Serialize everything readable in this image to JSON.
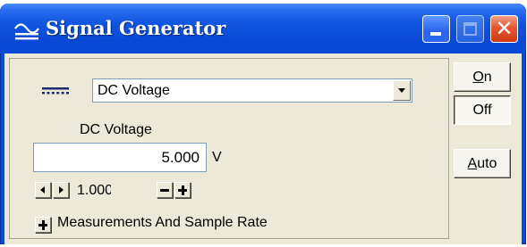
{
  "window": {
    "title": "Signal Generator",
    "icon": "signal-generator-icon",
    "controls": [
      "minimize-icon",
      "maximize-icon",
      "close-icon"
    ],
    "close_glyph": "✕"
  },
  "signal_type": {
    "icon": "dc-signal-icon",
    "selected": "DC Voltage"
  },
  "amplitude": {
    "label": "DC Voltage",
    "value": "5.000",
    "unit": "V",
    "step_value": "1.000"
  },
  "buttons": {
    "on_label": "On",
    "on_accel": "O",
    "on_rest": "n",
    "off_label": "Off",
    "auto_label": "Auto",
    "auto_accel": "A",
    "auto_rest": "uto"
  },
  "measurements": {
    "expand_glyph": "+",
    "label": "Measurements And Sample Rate"
  },
  "colors": {
    "titlebar": "#0b4ad1",
    "client_background": "#ece9d8",
    "close_button": "#e3572f"
  }
}
